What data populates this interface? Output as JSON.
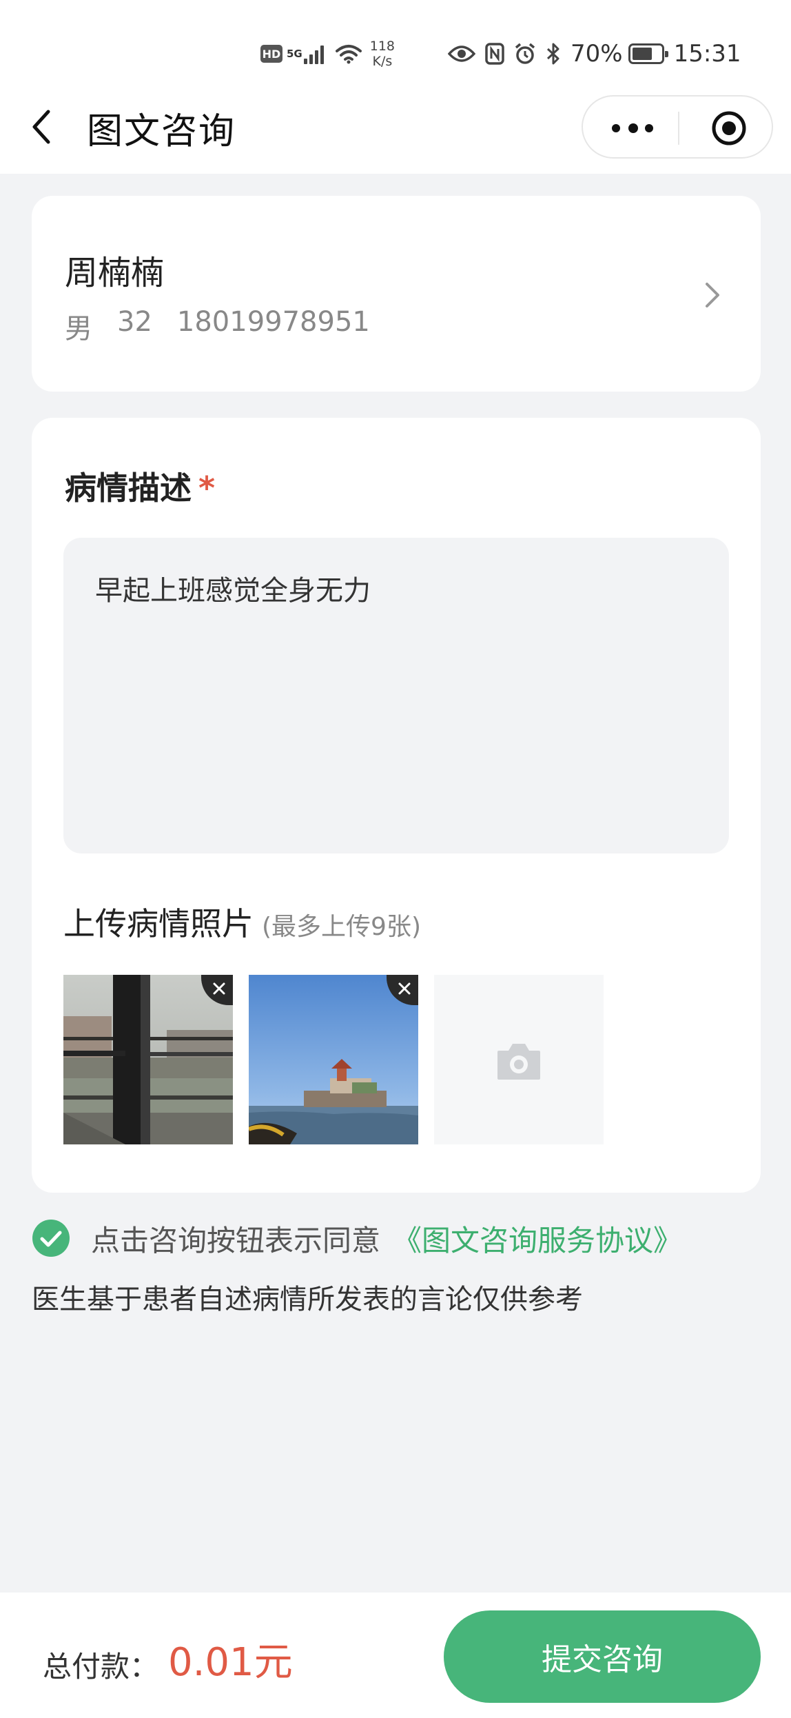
{
  "status_bar": {
    "hd": "HD",
    "network": "5G",
    "speed_value": "118",
    "speed_unit": "K/s",
    "battery_percent": "70%",
    "battery_level": 0.7,
    "time": "15:31"
  },
  "nav": {
    "title": "图文咨询",
    "icons": [
      "back-arrow-icon",
      "more-dots-icon",
      "target-circle-icon"
    ]
  },
  "patient": {
    "name": "周楠楠",
    "gender": "男",
    "age": "32",
    "phone": "18019978951"
  },
  "description": {
    "title": "病情描述",
    "required_mark": "*",
    "text": "早起上班感觉全身无力"
  },
  "upload": {
    "title": "上传病情照片",
    "hint": "(最多上传9张)",
    "photos": [
      "photo-building-window",
      "photo-lake-pavilion"
    ]
  },
  "agreement": {
    "text": "点击咨询按钮表示同意",
    "link": "《图文咨询服务协议》",
    "disclaimer": "医生基于患者自述病情所发表的言论仅供参考",
    "checked": true
  },
  "footer": {
    "total_label": "总付款：",
    "total_amount": "0.01元",
    "submit_label": "提交咨询"
  },
  "colors": {
    "accent_green": "#47b57a",
    "link_green": "#3daf6f",
    "price_red": "#e05a45",
    "page_bg": "#f2f3f5"
  }
}
